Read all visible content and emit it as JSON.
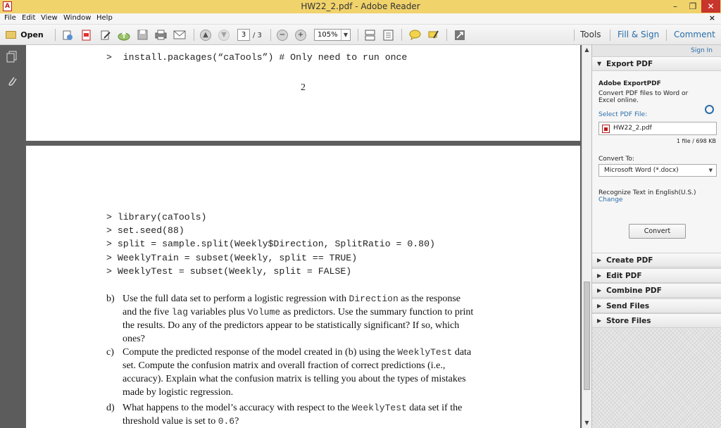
{
  "window": {
    "title": "HW22_2.pdf - Adobe Reader",
    "minimize": "–",
    "maximize": "❐",
    "close": "✕"
  },
  "menu": {
    "items": [
      "File",
      "Edit",
      "View",
      "Window",
      "Help"
    ],
    "doc_close": "×"
  },
  "toolbar": {
    "open_label": "Open",
    "page_current": "3",
    "page_total": "/ 3",
    "zoom": "105%",
    "tools": "Tools",
    "fill_sign": "Fill & Sign",
    "comment": "Comment"
  },
  "document": {
    "top_page_code": ">  install.packages(“caTools”) # Only need to run once",
    "top_page_number": "2",
    "code_lines": [
      "> library(caTools)",
      "> set.seed(88)",
      "> split = sample.split(Weekly$Direction, SplitRatio = 0.80)",
      "> WeeklyTrain = subset(Weekly, split == TRUE)",
      "> WeeklyTest = subset(Weekly, split = FALSE)"
    ],
    "q_b": {
      "letter": "b)",
      "l1a": "Use the full data set to perform a logistic regression with ",
      "l1code": "Direction",
      "l1b": " as the response",
      "l2a": "and the five ",
      "l2code1": "lag",
      "l2b": " variables plus ",
      "l2code2": "Volume",
      "l2c": " as predictors. Use the summary function to print",
      "l3": "the results. Do any of the predictors appear to be statistically significant? If so, which",
      "l4": "ones?"
    },
    "q_c": {
      "letter": "c)",
      "l1a": "Compute the predicted response of the model created in (b) using the ",
      "l1code": "WeeklyTest",
      "l1b": " data",
      "l2": "set. Compute the confusion matrix and overall fraction of correct predictions (i.e.,",
      "l3": "accuracy). Explain what the confusion matrix is telling you about the types of mistakes",
      "l4": "made by logistic regression."
    },
    "q_d": {
      "letter": "d)",
      "l1a": "What happens to the model’s accuracy with respect to the ",
      "l1code": "WeeklyTest",
      "l1b": " data set if the",
      "l2a": "threshold value is set to ",
      "l2code": "0.6",
      "l2b": "?"
    }
  },
  "right_pane": {
    "sign_in": "Sign In",
    "export_pdf": "Export PDF",
    "adobe_exportpdf": "Adobe ExportPDF",
    "description": "Convert PDF files to Word or Excel online.",
    "select_file": "Select PDF File:",
    "file_name": "HW22_2.pdf",
    "file_count": "1 file / 698 KB",
    "convert_to": "Convert To:",
    "convert_format": "Microsoft Word (*.docx)",
    "recognize": "Recognize Text in English(U.S.)",
    "change": "Change",
    "convert_button": "Convert",
    "panels": [
      "Create PDF",
      "Edit PDF",
      "Combine PDF",
      "Send Files",
      "Store Files"
    ]
  }
}
